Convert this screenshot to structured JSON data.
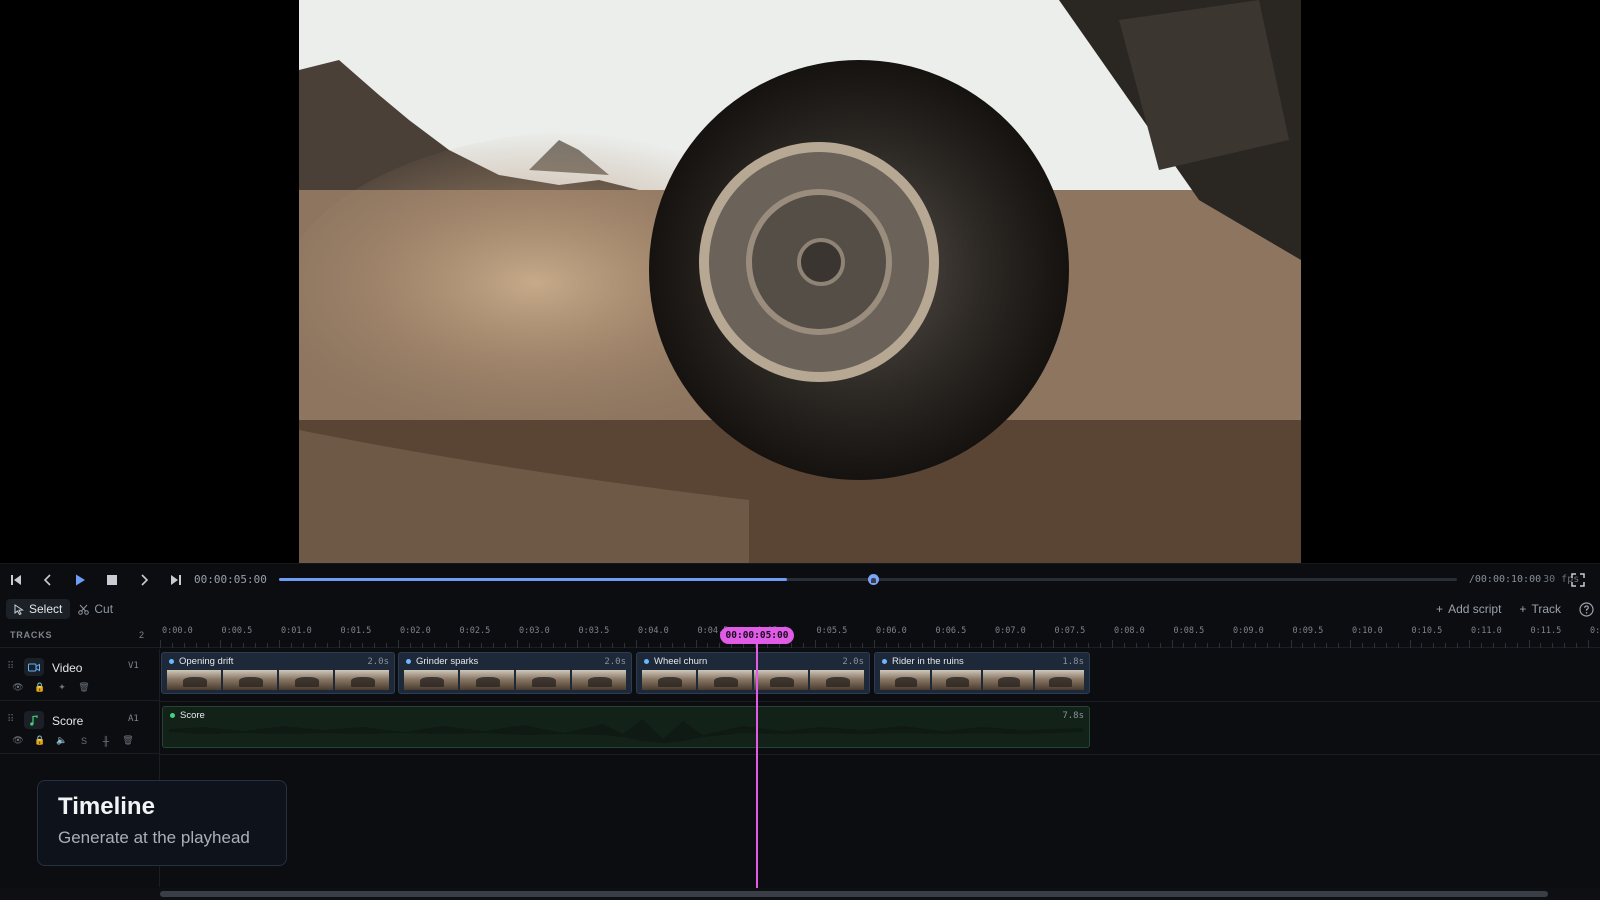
{
  "transport": {
    "current_time": "00:00:05:00",
    "duration": "/00:00:10:00",
    "fps": "30 fps",
    "progress": 0.5,
    "buttons": [
      "skip-start",
      "prev-frame",
      "play",
      "stop",
      "next-frame",
      "skip-end"
    ]
  },
  "toolbar": {
    "select_label": "Select",
    "cut_label": "Cut",
    "add_script_label": "Add script",
    "track_label": "Track"
  },
  "ruler": {
    "tracks_label": "TRACKS",
    "tracks_count": "2",
    "ticks": [
      "0:00.0",
      "0:00.5",
      "0:01.0",
      "0:01.5",
      "0:02.0",
      "0:02.5",
      "0:03.0",
      "0:03.5",
      "0:04.0",
      "0:04.5",
      "0:05.0",
      "0:05.5",
      "0:06.0",
      "0:06.5",
      "0:07.0",
      "0:07.5",
      "0:08.0",
      "0:08.5",
      "0:09.0",
      "0:09.5",
      "0:10.0",
      "0:10.5",
      "0:11.0",
      "0:11.5",
      "0:1"
    ]
  },
  "playhead": {
    "label": "00:00:05:00"
  },
  "tracks": [
    {
      "name": "Video",
      "tag": "V1",
      "clips": [
        {
          "title": "Opening drift",
          "duration": "2.0s"
        },
        {
          "title": "Grinder sparks",
          "duration": "2.0s"
        },
        {
          "title": "Wheel churn",
          "duration": "2.0s"
        },
        {
          "title": "Rider in the ruins",
          "duration": "1.8s"
        }
      ]
    },
    {
      "name": "Score",
      "tag": "A1",
      "clips": [
        {
          "title": "Score",
          "duration": "7.8s"
        }
      ]
    }
  ],
  "tooltip": {
    "title": "Timeline",
    "subtitle": "Generate at the playhead"
  },
  "colors": {
    "accent": "#6f9cf5",
    "playhead": "#e05be6",
    "video_clip": "#1d2838",
    "audio_clip": "#132219"
  }
}
